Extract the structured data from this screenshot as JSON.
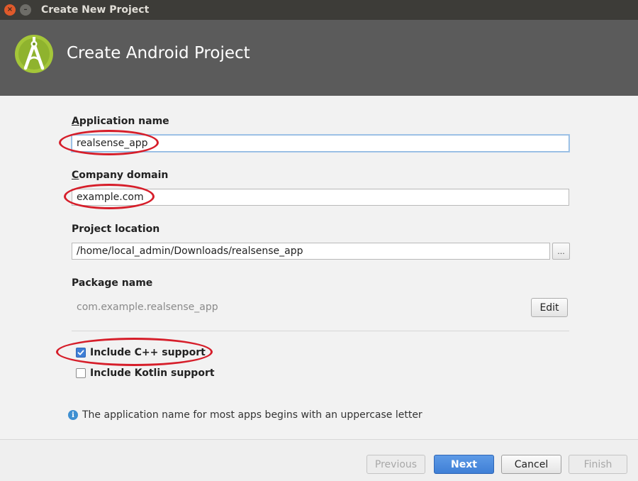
{
  "window": {
    "title": "Create New Project",
    "close_glyph": "×",
    "minimize_glyph": "–"
  },
  "header": {
    "title": "Create Android Project"
  },
  "form": {
    "app_name": {
      "label_first": "A",
      "label_rest": "pplication name",
      "value": "realsense_app"
    },
    "company_domain": {
      "label_first": "C",
      "label_rest": "ompany domain",
      "value": "example.com"
    },
    "project_location": {
      "label": "Project location",
      "value": "/home/local_admin/Downloads/realsense_app",
      "browse_label": "..."
    },
    "package_name": {
      "label": "Package name",
      "value": "com.example.realsense_app",
      "edit_label": "Edit"
    },
    "cpp_support": {
      "label": "Include C++ support",
      "checked": true
    },
    "kotlin_support": {
      "label": "Include Kotlin support",
      "checked": false
    }
  },
  "info": {
    "icon_glyph": "i",
    "text": "The application name for most apps begins with an uppercase letter"
  },
  "footer": {
    "previous": "Previous",
    "next": "Next",
    "cancel": "Cancel",
    "finish": "Finish"
  },
  "colors": {
    "annotation": "#d61e2a",
    "primary": "#3f7fd6",
    "header_bg": "#5b5b5b",
    "android_green": "#a4c639"
  },
  "icons": {
    "logo": "android-studio-logo-icon",
    "info": "info-icon",
    "checkmark": "checkmark-icon"
  }
}
